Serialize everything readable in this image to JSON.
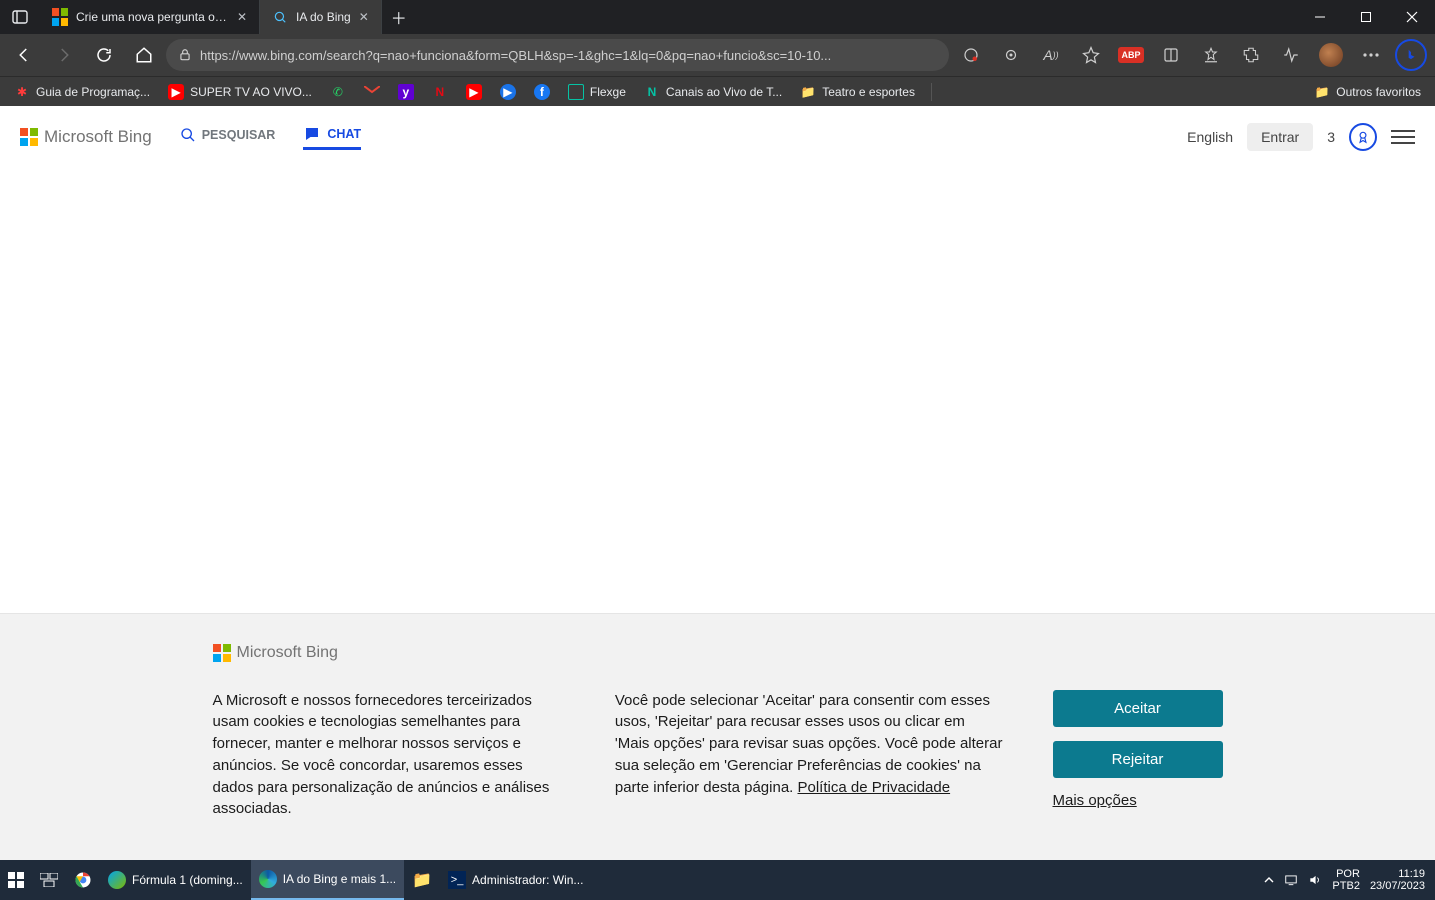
{
  "titlebar": {
    "tabs": [
      {
        "title": "Crie uma nova pergunta ou inicia...",
        "active": false
      },
      {
        "title": "IA do Bing",
        "active": true
      }
    ]
  },
  "toolbar": {
    "url": "https://www.bing.com/search?q=nao+funciona&form=QBLH&sp=-1&ghc=1&lq=0&pq=nao+funcio&sc=10-10...",
    "abp": "ABP"
  },
  "bookmarks": {
    "items": [
      {
        "label": "Guia de Programaç..."
      },
      {
        "label": "SUPER TV AO VIVO..."
      },
      {
        "label": ""
      },
      {
        "label": ""
      },
      {
        "label": ""
      },
      {
        "label": ""
      },
      {
        "label": ""
      },
      {
        "label": ""
      },
      {
        "label": ""
      },
      {
        "label": "Flexge"
      },
      {
        "label": "Canais ao Vivo de T..."
      },
      {
        "label": "Teatro e esportes"
      }
    ],
    "other": "Outros favoritos"
  },
  "bing": {
    "logo": "Microsoft Bing",
    "search_label": "PESQUISAR",
    "chat_label": "CHAT",
    "language": "English",
    "signin": "Entrar",
    "points": "3"
  },
  "cookie": {
    "logo": "Microsoft Bing",
    "col1": "A Microsoft e nossos fornecedores terceirizados usam cookies e tecnologias semelhantes para fornecer, manter e melhorar nossos serviços e anúncios. Se você concordar, usaremos esses dados para personalização de anúncios e análises associadas.",
    "col2_pre": "Você pode selecionar 'Aceitar' para consentir com esses usos, 'Rejeitar' para recusar esses usos ou clicar em 'Mais opções' para revisar suas opções. Você pode alterar sua seleção em 'Gerenciar Preferências de cookies' na parte inferior desta página.  ",
    "policy_link": "Política de Privacidade",
    "accept": "Aceitar",
    "reject": "Rejeitar",
    "more": "Mais opções"
  },
  "taskbar": {
    "items": [
      {
        "label": ""
      },
      {
        "label": ""
      },
      {
        "label": ""
      },
      {
        "label": "Fórmula 1 (doming..."
      },
      {
        "label": "IA do Bing e mais 1..."
      },
      {
        "label": ""
      },
      {
        "label": "Administrador: Win..."
      }
    ],
    "lang1": "POR",
    "lang2": "PTB2",
    "time": "11:19",
    "date": "23/07/2023"
  }
}
